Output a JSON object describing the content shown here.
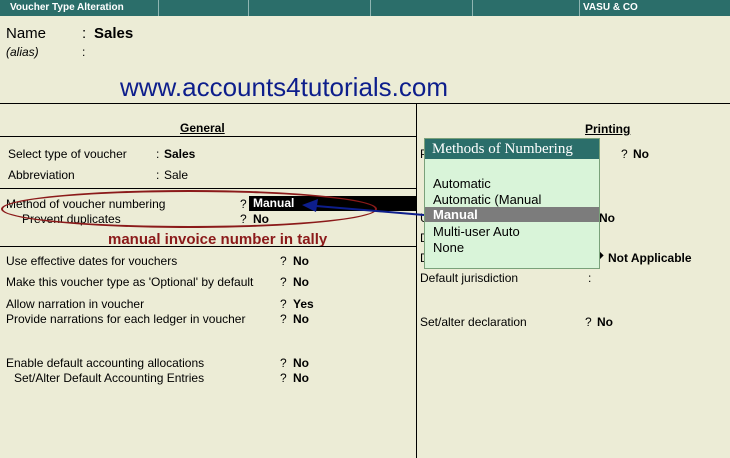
{
  "window": {
    "title": "Voucher Type Alteration",
    "company": "VASU & CO"
  },
  "header": {
    "name_label": "Name",
    "name_colon": ":",
    "name_value": "Sales",
    "alias_label": "(alias)",
    "alias_colon": ":"
  },
  "watermark": "www.accounts4tutorials.com",
  "general": {
    "heading": "General",
    "select_type_label": "Select type of voucher",
    "select_type_sep": ":",
    "select_type_value": "Sales",
    "abbreviation_label": "Abbreviation",
    "abbreviation_sep": ":",
    "abbreviation_value": "Sale",
    "numbering_label": "Method of voucher numbering",
    "numbering_q": "?",
    "numbering_value": "Manual",
    "prevent_label": "Prevent duplicates",
    "prevent_q": "?",
    "prevent_value": "No",
    "annotation": "manual invoice number in tally",
    "rows": [
      {
        "label": "Use effective dates for vouchers",
        "q": "?",
        "value": "No"
      },
      {
        "label": "Make this voucher type as 'Optional' by default",
        "q": "?",
        "value": "No"
      },
      {
        "label": "Allow narration in voucher",
        "q": "?",
        "value": "Yes"
      },
      {
        "label": "Provide narrations for each ledger in voucher",
        "q": "?",
        "value": "No"
      },
      {
        "label": "Enable default accounting allocations",
        "q": "?",
        "value": "No"
      },
      {
        "label": "Set/Alter Default Accounting Entries",
        "q": "?",
        "value": "No"
      }
    ]
  },
  "printing": {
    "heading": "Printing",
    "row1_partial": "P",
    "row1_q": "?",
    "row1_value": "No",
    "row2_partial": "U",
    "row2_value": "No",
    "row3_partial": "D",
    "row4_partial": "D",
    "row4_value": "Not Applicable",
    "jurisdiction_label": "Default jurisdiction",
    "jurisdiction_sep": ":",
    "declaration_label": "Set/alter declaration",
    "declaration_q": "?",
    "declaration_value": "No"
  },
  "popup": {
    "title": "Methods of Numbering",
    "options": [
      "Automatic",
      "Automatic (Manual Override)",
      "Manual",
      "Multi-user Auto",
      "None"
    ],
    "selected": "Manual"
  },
  "colors": {
    "titlebar": "#2b6e6a",
    "background": "#ececd6",
    "annotation": "#8b1a1a",
    "watermark": "#0d1e8c",
    "popup_bg": "#d9f4d9",
    "selection": "#7c7c7c"
  }
}
